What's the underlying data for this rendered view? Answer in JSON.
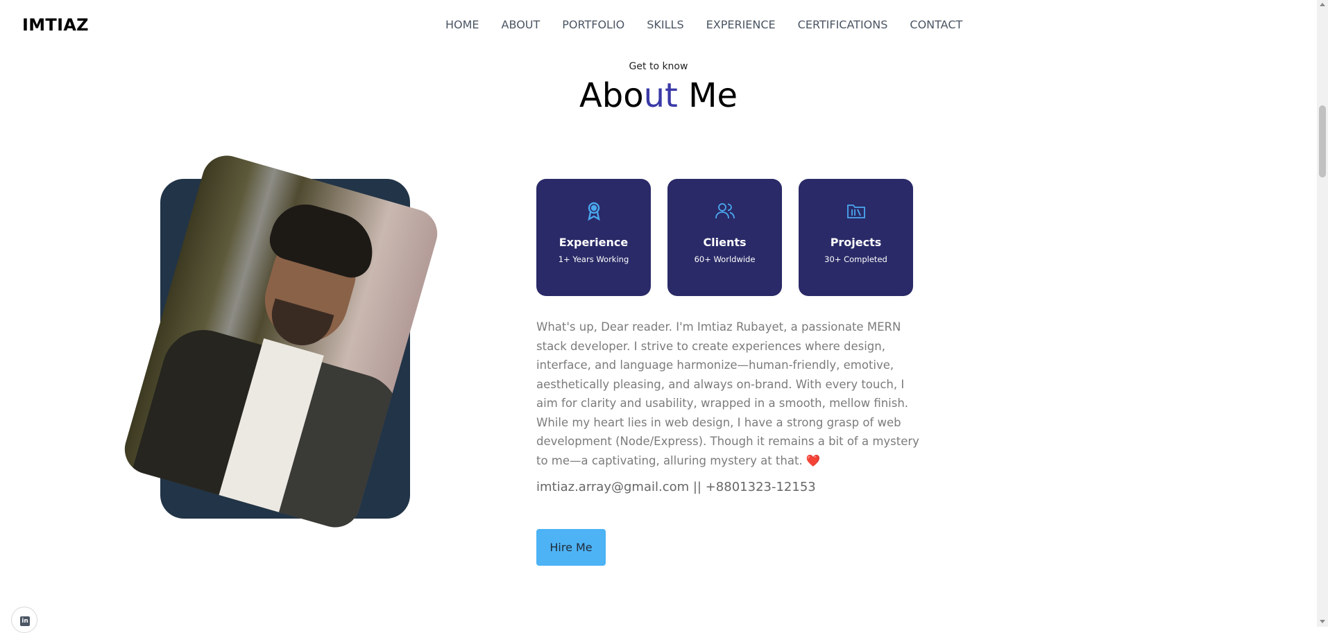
{
  "header": {
    "logo": "IMTIAZ",
    "nav": [
      "HOME",
      "ABOUT",
      "PORTFOLIO",
      "SKILLS",
      "EXPERIENCE",
      "CERTIFICATIONS",
      "CONTACT"
    ]
  },
  "about": {
    "eyebrow": "Get to know",
    "title_part1": "Abo",
    "title_accent": "ut",
    "title_part2": " Me",
    "cards": [
      {
        "icon": "award-icon",
        "title": "Experience",
        "subtitle": "1+ Years Working"
      },
      {
        "icon": "users-icon",
        "title": "Clients",
        "subtitle": "60+ Worldwide"
      },
      {
        "icon": "folder-icon",
        "title": "Projects",
        "subtitle": "30+ Completed"
      }
    ],
    "bio": "What's up, Dear reader. I'm Imtiaz Rubayet, a passionate MERN stack developer. I strive to create experiences where design, interface, and language harmonize—human-friendly, emotive, aesthetically pleasing, and always on-brand. With every touch, I aim for clarity and usability, wrapped in a smooth, mellow finish. While my heart lies in web design, I have a strong grasp of web development (Node/Express). Though it remains a bit of a mystery to me—a captivating, alluring mystery at that.",
    "heart": "❤️",
    "contact": "imtiaz.array@gmail.com || +8801323-12153",
    "hire_label": "Hire Me"
  },
  "social": {
    "icon": "linkedin-icon"
  },
  "colors": {
    "card_bg": "#2a2a68",
    "accent": "#3b3aa8",
    "icon_blue": "#4aa8f0",
    "button_bg": "#4db3f5",
    "photo_frame": "#223447"
  }
}
